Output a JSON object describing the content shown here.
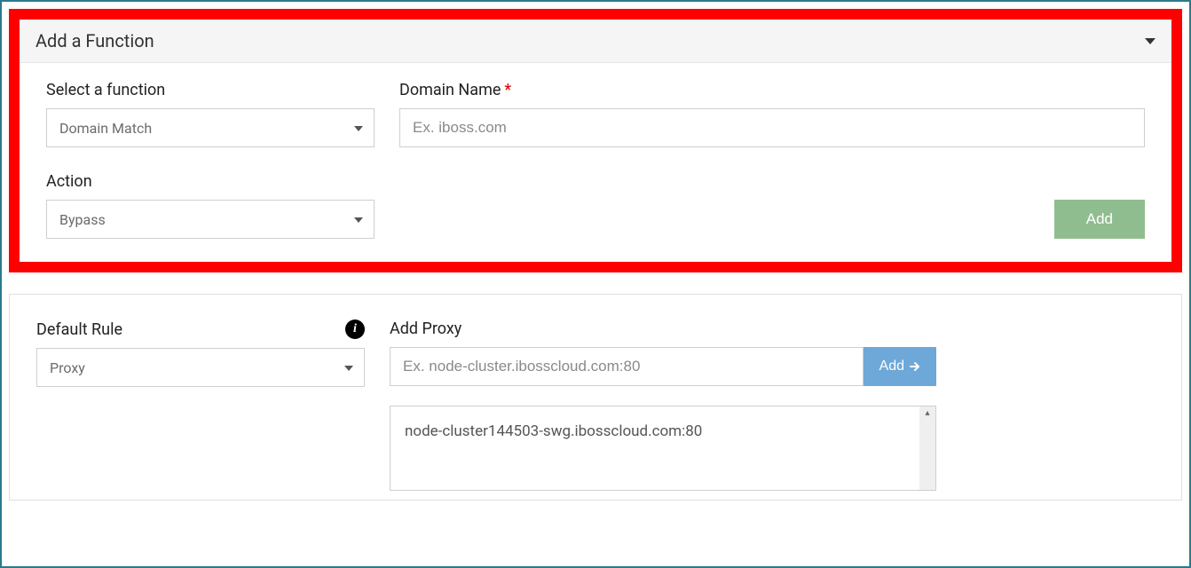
{
  "addFunction": {
    "title": "Add a Function",
    "selectFunctionLabel": "Select a function",
    "selectFunctionValue": "Domain Match",
    "domainNameLabel": "Domain Name",
    "domainPlaceholder": "Ex. iboss.com",
    "actionLabel": "Action",
    "actionValue": "Bypass",
    "addButton": "Add"
  },
  "defaultRule": {
    "label": "Default Rule",
    "value": "Proxy"
  },
  "addProxy": {
    "label": "Add Proxy",
    "placeholder": "Ex. node-cluster.ibosscloud.com:80",
    "addButton": "Add",
    "listItem": "node-cluster144503-swg.ibosscloud.com:80"
  }
}
